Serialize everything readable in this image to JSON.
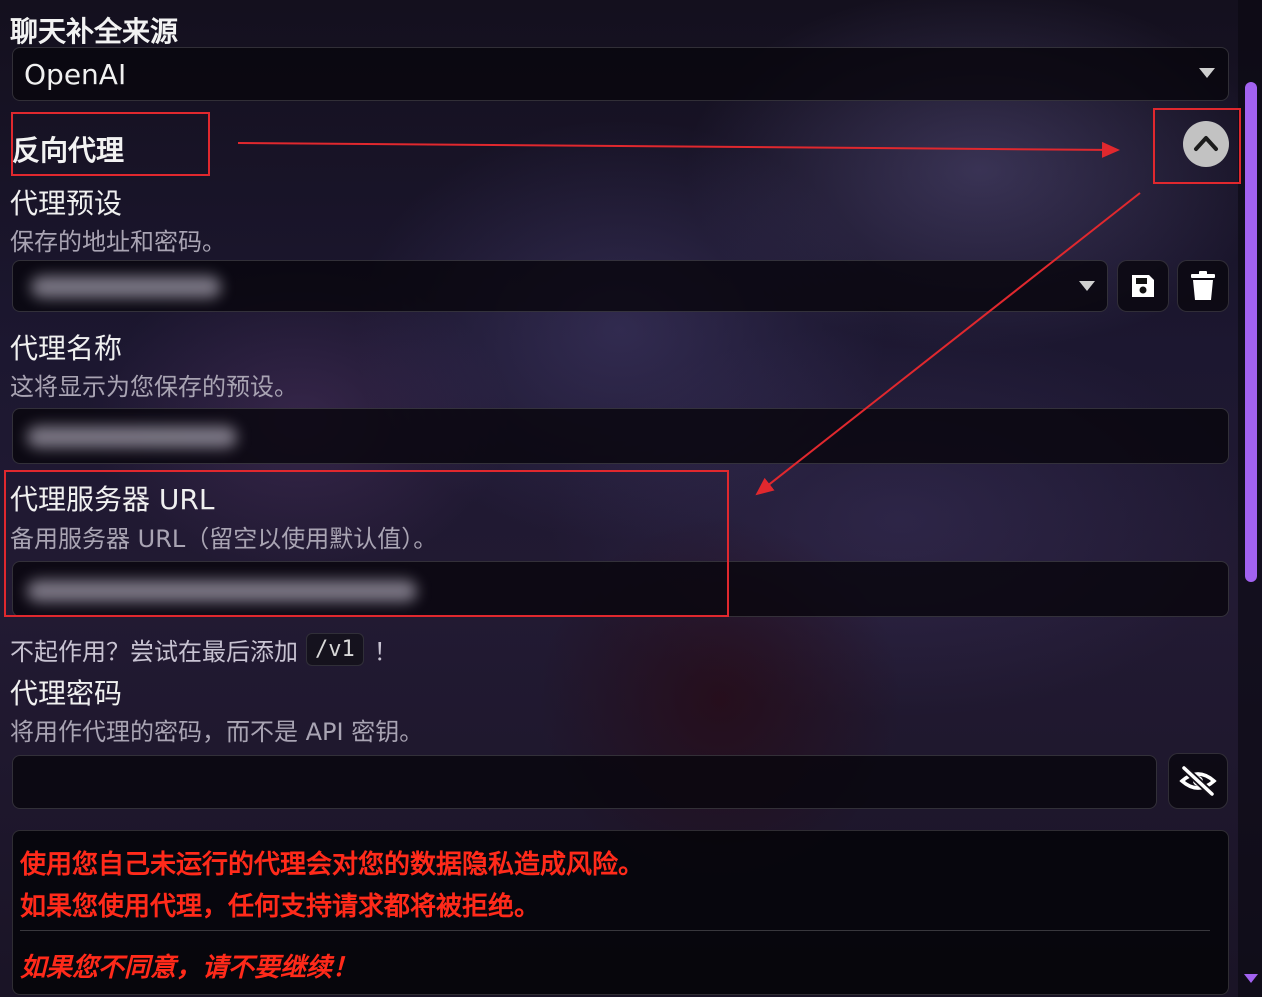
{
  "chat_source": {
    "label": "聊天补全来源",
    "selected": "OpenAI"
  },
  "reverse_proxy": {
    "section_title": "反向代理",
    "toggle_icon": "chevron-up-icon"
  },
  "proxy_preset": {
    "label": "代理预设",
    "description": "保存的地址和密码。",
    "save_icon": "save-icon",
    "delete_icon": "trash-icon"
  },
  "proxy_name": {
    "label": "代理名称",
    "description": "这将显示为您保存的预设。"
  },
  "proxy_url": {
    "label": "代理服务器 URL",
    "description": "备用服务器 URL（留空以使用默认值）。"
  },
  "hint": {
    "prefix": "不起作用？尝试在最后添加",
    "code": "/v1",
    "suffix": "！"
  },
  "proxy_password": {
    "label": "代理密码",
    "description": "将用作代理的密码，而不是 API 密钥。",
    "visibility_icon": "eye-slash-icon"
  },
  "warning": {
    "line1": "使用您自己未运行的代理会对您的数据隐私造成风险。",
    "line2": "如果您使用代理，任何支持请求都将被拒绝。",
    "line3": "如果您不同意，请不要继续！"
  },
  "colors": {
    "annotation_red": "#e0282e",
    "warning_red": "#ff2a1a",
    "scrollbar_thumb": "#a262f0"
  }
}
